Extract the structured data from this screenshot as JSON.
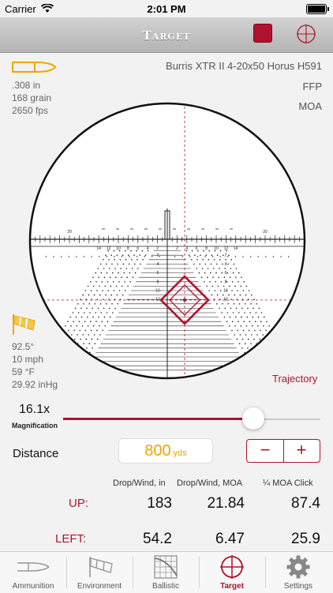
{
  "status": {
    "carrier": "Carrier",
    "time": "2:01 PM"
  },
  "nav": {
    "title": "Target"
  },
  "ammo": {
    "caliber": ".308 in",
    "weight": "168 grain",
    "velocity": "2650 fps"
  },
  "scope": {
    "name": "Burris XTR II 4-20x50 Horus H591",
    "plane": "FFP",
    "unit": "MOA"
  },
  "environment": {
    "wind_direction": "92.5°",
    "wind_speed": "10 mph",
    "temperature": "59 °F",
    "pressure": "29.92 inHg"
  },
  "trajectory_label": "Trajectory",
  "magnification": {
    "value": "16.1x",
    "label": "Magnification",
    "fraction": 0.74
  },
  "distance": {
    "label": "Distance",
    "value": "800",
    "unit": "yds",
    "minus": "−",
    "plus": "+"
  },
  "results": {
    "headers": [
      "Drop/Wind, in",
      "Drop/Wind, MOA",
      "¼ MOA Click"
    ],
    "rows": [
      {
        "label": "UP:",
        "values": [
          "183",
          "21.84",
          "87.4"
        ]
      },
      {
        "label": "LEFT:",
        "values": [
          "54.2",
          "6.47",
          "25.9"
        ]
      }
    ]
  },
  "reticle": {
    "horizontal_labels": [
      "20",
      "14",
      "12",
      "10",
      "8",
      "6",
      "4",
      "2",
      "2",
      "4",
      "6",
      "8",
      "10",
      "12",
      "14",
      "20"
    ],
    "vertical_labels": [
      "2",
      "4",
      "6",
      "8",
      "10",
      "12"
    ]
  },
  "tabs": [
    {
      "label": "Ammunition",
      "icon": "bullet-icon",
      "active": false
    },
    {
      "label": "Environment",
      "icon": "windsock-icon",
      "active": false
    },
    {
      "label": "Ballistic",
      "icon": "ballistic-grid-icon",
      "active": false
    },
    {
      "label": "Target",
      "icon": "crosshair-icon",
      "active": true
    },
    {
      "label": "Settings",
      "icon": "gear-icon",
      "active": false
    }
  ],
  "colors": {
    "accent": "#b1122c",
    "distance": "#f0a500",
    "ammo_icon": "#f0a500"
  }
}
